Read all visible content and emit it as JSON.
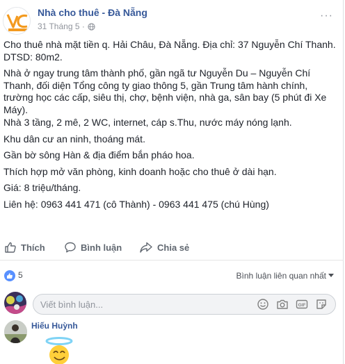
{
  "post": {
    "page_name": "Nhà cho thuê - Đà Nẵng",
    "logo_text": "VC",
    "date": "31 Tháng 5 ·",
    "more_label": "···",
    "paragraphs": [
      "Cho thuê nhà mặt tiền q. Hải Châu, Đà Nẵng. Địa chỉ: 37 Nguyễn Chí Thanh. DTSD: 80m2.",
      "Nhà ở ngay trung tâm thành phố, gần ngã tư Nguyễn Du – Nguyễn Chí Thanh, đối diện Tổng công ty giao thông 5, gần Trung tâm hành chính, trường học các cấp, siêu thị, chợ, bệnh viện, nhà ga, sân bay (5 phút đi Xe Máy).",
      "Nhà 3 tầng, 2 mê, 2 WC, internet, cáp s.Thu, nước máy nóng lạnh.",
      "Khu dân cư an ninh, thoáng mát.",
      "Gần bờ sông Hàn & địa điểm bắn pháo hoa.",
      "Thích hợp mở văn phòng, kinh doanh hoặc cho thuê ở dài hạn.",
      "Giá: 8 triệu/tháng.",
      "Liên hệ: 0963 441 471 (cô Thành) - 0963 441 475 (chú Hùng)"
    ]
  },
  "actions": {
    "like_label": "Thích",
    "comment_label": "Bình luận",
    "share_label": "Chia sẻ"
  },
  "reactions": {
    "count": "5",
    "sort_label": "Bình luận liên quan nhất"
  },
  "comment_composer": {
    "placeholder": "Viết bình luận..."
  },
  "comments": [
    {
      "author": "Hiếu Huỳnh"
    }
  ],
  "colors": {
    "link": "#365899",
    "meta": "#90949c",
    "action": "#606770",
    "like_blue": "#5890ff",
    "logo_orange": "#f39a1f"
  },
  "icons": {
    "globe": "globe-icon",
    "like": "thumbs-up-icon",
    "comment": "speech-bubble-icon",
    "share": "share-arrow-icon",
    "emoji": "smiley-icon",
    "camera": "camera-icon",
    "gif": "gif-icon",
    "sticker": "sticker-icon"
  }
}
